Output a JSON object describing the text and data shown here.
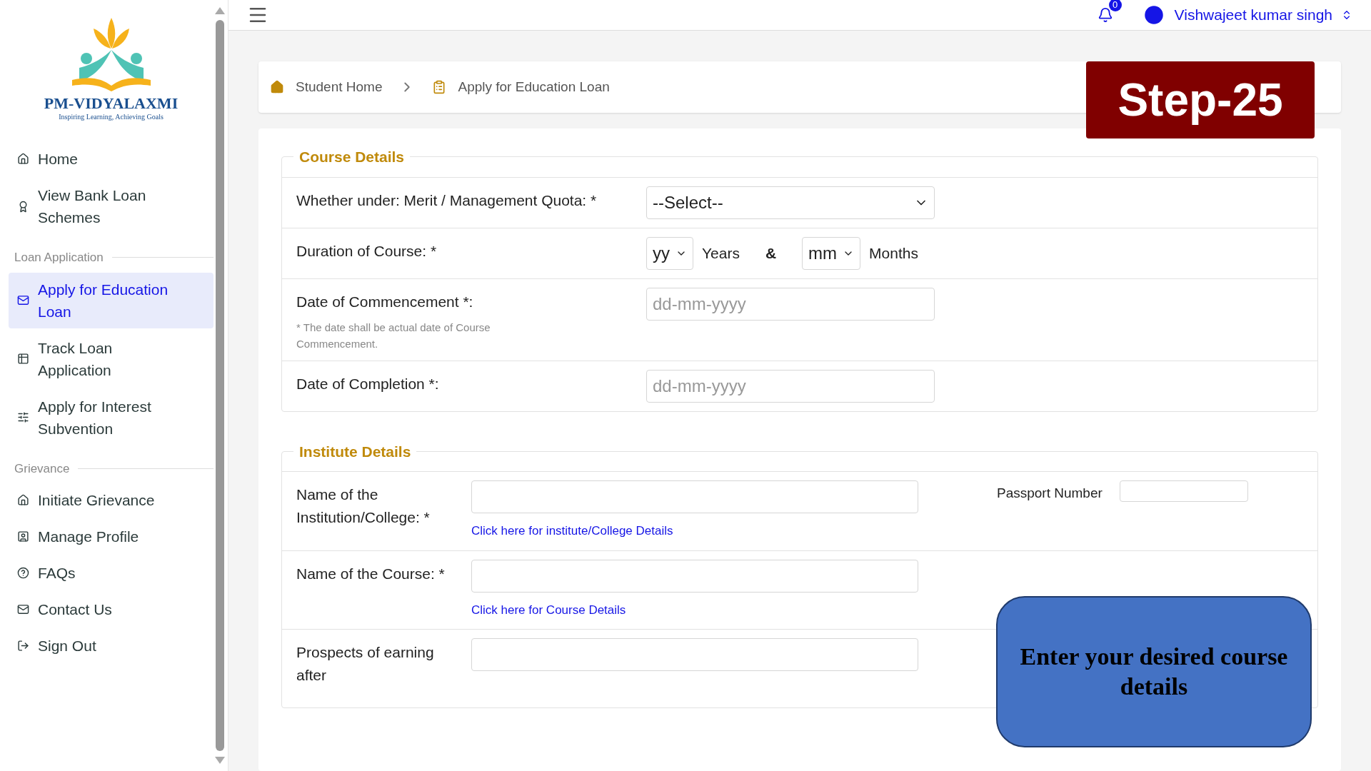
{
  "header": {
    "notification_count": "0",
    "user_name": "Vishwajeet kumar singh"
  },
  "sidebar": {
    "logo": {
      "title": "PM-VIDYALAXMI",
      "tagline": "Inspiring Learning, Achieving Goals"
    },
    "items": [
      {
        "kind": "link",
        "label": "Home",
        "selected": false
      },
      {
        "kind": "link",
        "label": "View Bank Loan Schemes",
        "selected": false
      },
      {
        "kind": "heading",
        "label": "Loan Application"
      },
      {
        "kind": "link",
        "label": "Apply for Education Loan",
        "selected": true
      },
      {
        "kind": "link",
        "label": "Track Loan Application",
        "selected": false
      },
      {
        "kind": "link",
        "label": "Apply for Interest Subvention",
        "selected": false
      },
      {
        "kind": "heading",
        "label": "Grievance"
      },
      {
        "kind": "link",
        "label": "Initiate Grievance",
        "selected": false
      },
      {
        "kind": "link",
        "label": "Manage Profile",
        "selected": false
      },
      {
        "kind": "link",
        "label": "FAQs",
        "selected": false
      },
      {
        "kind": "link",
        "label": "Contact Us",
        "selected": false
      },
      {
        "kind": "link",
        "label": "Sign Out",
        "selected": false
      }
    ]
  },
  "breadcrumb": [
    {
      "label": "Student Home"
    },
    {
      "label": "Apply for Education Loan"
    }
  ],
  "step_badge": "Step-25",
  "sections": [
    {
      "title": "Course Details",
      "rows": [
        {
          "kind": "select",
          "label": "Whether under: Merit / Management Quota: *",
          "value": "--Select--"
        },
        {
          "kind": "duration",
          "label": "Duration of Course: *",
          "years_value": "yy",
          "years_unit": "Years",
          "joiner": "&",
          "months_value": "mm",
          "months_unit": "Months"
        },
        {
          "kind": "date",
          "label": "Date of Commencement *:",
          "note": "* The date shall be actual date of Course Commencement.",
          "placeholder": "dd-mm-yyyy"
        },
        {
          "kind": "date",
          "label": "Date of Completion *:",
          "placeholder": "dd-mm-yyyy"
        }
      ]
    },
    {
      "title": "Institute Details",
      "rows": [
        {
          "kind": "text",
          "label": "Name of the Institution/College: *",
          "link": "Click here for institute/College Details",
          "side_label": "Passport Number"
        },
        {
          "kind": "text",
          "label": "Name of the Course: *",
          "link": "Click here for Course Details"
        },
        {
          "kind": "text",
          "label": "Prospects of earning after"
        }
      ]
    }
  ],
  "callout": "Enter your desired course details"
}
